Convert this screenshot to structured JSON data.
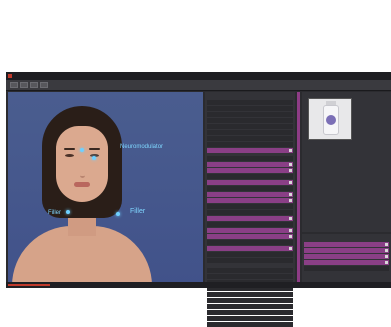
{
  "window": {
    "title": "",
    "accent_color": "#c0392b",
    "highlight_color": "#8a3f86"
  },
  "toolbar": {
    "buttons": [
      "play-icon",
      "stop-icon",
      "rewind-icon",
      "forward-icon"
    ]
  },
  "viewport": {
    "labels": {
      "top_label": "Neuromodulator",
      "left_label": "Filler",
      "right_label": "Filler"
    }
  },
  "middle_panel": {
    "header": "",
    "list_a_count": 9,
    "list_b_count": 18,
    "list_c_count": 10
  },
  "right_panel": {
    "header": "",
    "product_title": "",
    "description": "",
    "bottom_header": ""
  }
}
